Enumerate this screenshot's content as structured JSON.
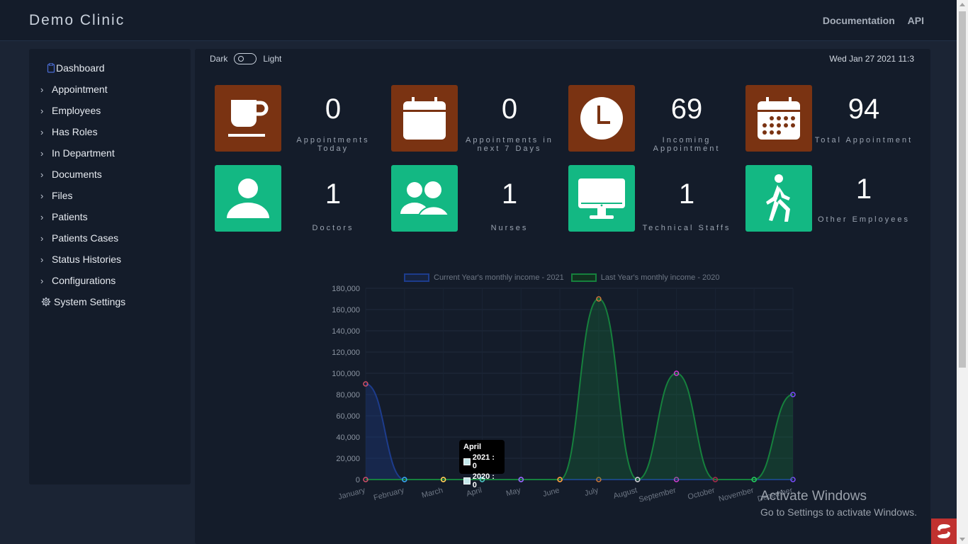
{
  "header": {
    "brand": "Demo Clinic",
    "links": [
      "Documentation",
      "API"
    ]
  },
  "sidebar": {
    "items": [
      {
        "label": "Dashboard",
        "icon": "clipboard-icon"
      },
      {
        "label": "Appointment",
        "icon": "chevron-right-icon"
      },
      {
        "label": "Employees",
        "icon": "chevron-right-icon"
      },
      {
        "label": "Has Roles",
        "icon": "chevron-right-icon"
      },
      {
        "label": "In Department",
        "icon": "chevron-right-icon"
      },
      {
        "label": "Documents",
        "icon": "chevron-right-icon"
      },
      {
        "label": "Files",
        "icon": "chevron-right-icon"
      },
      {
        "label": "Patients",
        "icon": "chevron-right-icon"
      },
      {
        "label": "Patients Cases",
        "icon": "chevron-right-icon"
      },
      {
        "label": "Status Histories",
        "icon": "chevron-right-icon"
      },
      {
        "label": "Configurations",
        "icon": "chevron-right-icon"
      },
      {
        "label": "System Settings",
        "icon": "gear-icon"
      }
    ]
  },
  "theme": {
    "dark_label": "Dark",
    "light_label": "Light"
  },
  "datetime": "Wed Jan 27 2021 11:3",
  "stats": [
    {
      "value": "0",
      "label": "Appointments Today",
      "icon": "coffee-cup-icon",
      "color": "#7a3312"
    },
    {
      "value": "0",
      "label": "Appointments in next 7 Days",
      "icon": "calendar-icon",
      "color": "#7a3312"
    },
    {
      "value": "69",
      "label": "Incoming Appointment",
      "icon": "clock-icon",
      "color": "#7a3312"
    },
    {
      "value": "94",
      "label": "Total Appointment",
      "icon": "calendar-dots-icon",
      "color": "#7a3312"
    },
    {
      "value": "1",
      "label": "Doctors",
      "icon": "user-icon",
      "color": "#13b883"
    },
    {
      "value": "1",
      "label": "Nurses",
      "icon": "users-icon",
      "color": "#13b883"
    },
    {
      "value": "1",
      "label": "Technical Staffs",
      "icon": "desktop-icon",
      "color": "#13b883"
    },
    {
      "value": "1",
      "label": "Other Employees",
      "icon": "walking-icon",
      "color": "#13b883"
    }
  ],
  "chart_data": {
    "type": "line",
    "categories": [
      "January",
      "February",
      "March",
      "April",
      "May",
      "June",
      "July",
      "August",
      "September",
      "October",
      "November",
      "December"
    ],
    "series": [
      {
        "name": "Current Year's monthly income - 2021",
        "values": [
          90000,
          0,
          0,
          0,
          0,
          0,
          0,
          0,
          0,
          0,
          0,
          0
        ],
        "color": "#1d3c8c"
      },
      {
        "name": "Last Year's monthly income - 2020",
        "values": [
          0,
          0,
          0,
          0,
          0,
          0,
          170000,
          0,
          100000,
          0,
          0,
          80000
        ],
        "color": "#16803d"
      }
    ],
    "ylim": [
      0,
      180000
    ],
    "yticks": [
      "180,000",
      "160,000",
      "140,000",
      "120,000",
      "100,000",
      "80,000",
      "60,000",
      "40,000",
      "20,000",
      "0"
    ],
    "grid": true,
    "legend": "top"
  },
  "tooltip": {
    "title": "April",
    "rows": [
      "2021 : 0",
      "2020 : 0"
    ]
  },
  "watermark": {
    "line1": "Activate Windows",
    "line2": "Go to Settings to activate Windows."
  }
}
